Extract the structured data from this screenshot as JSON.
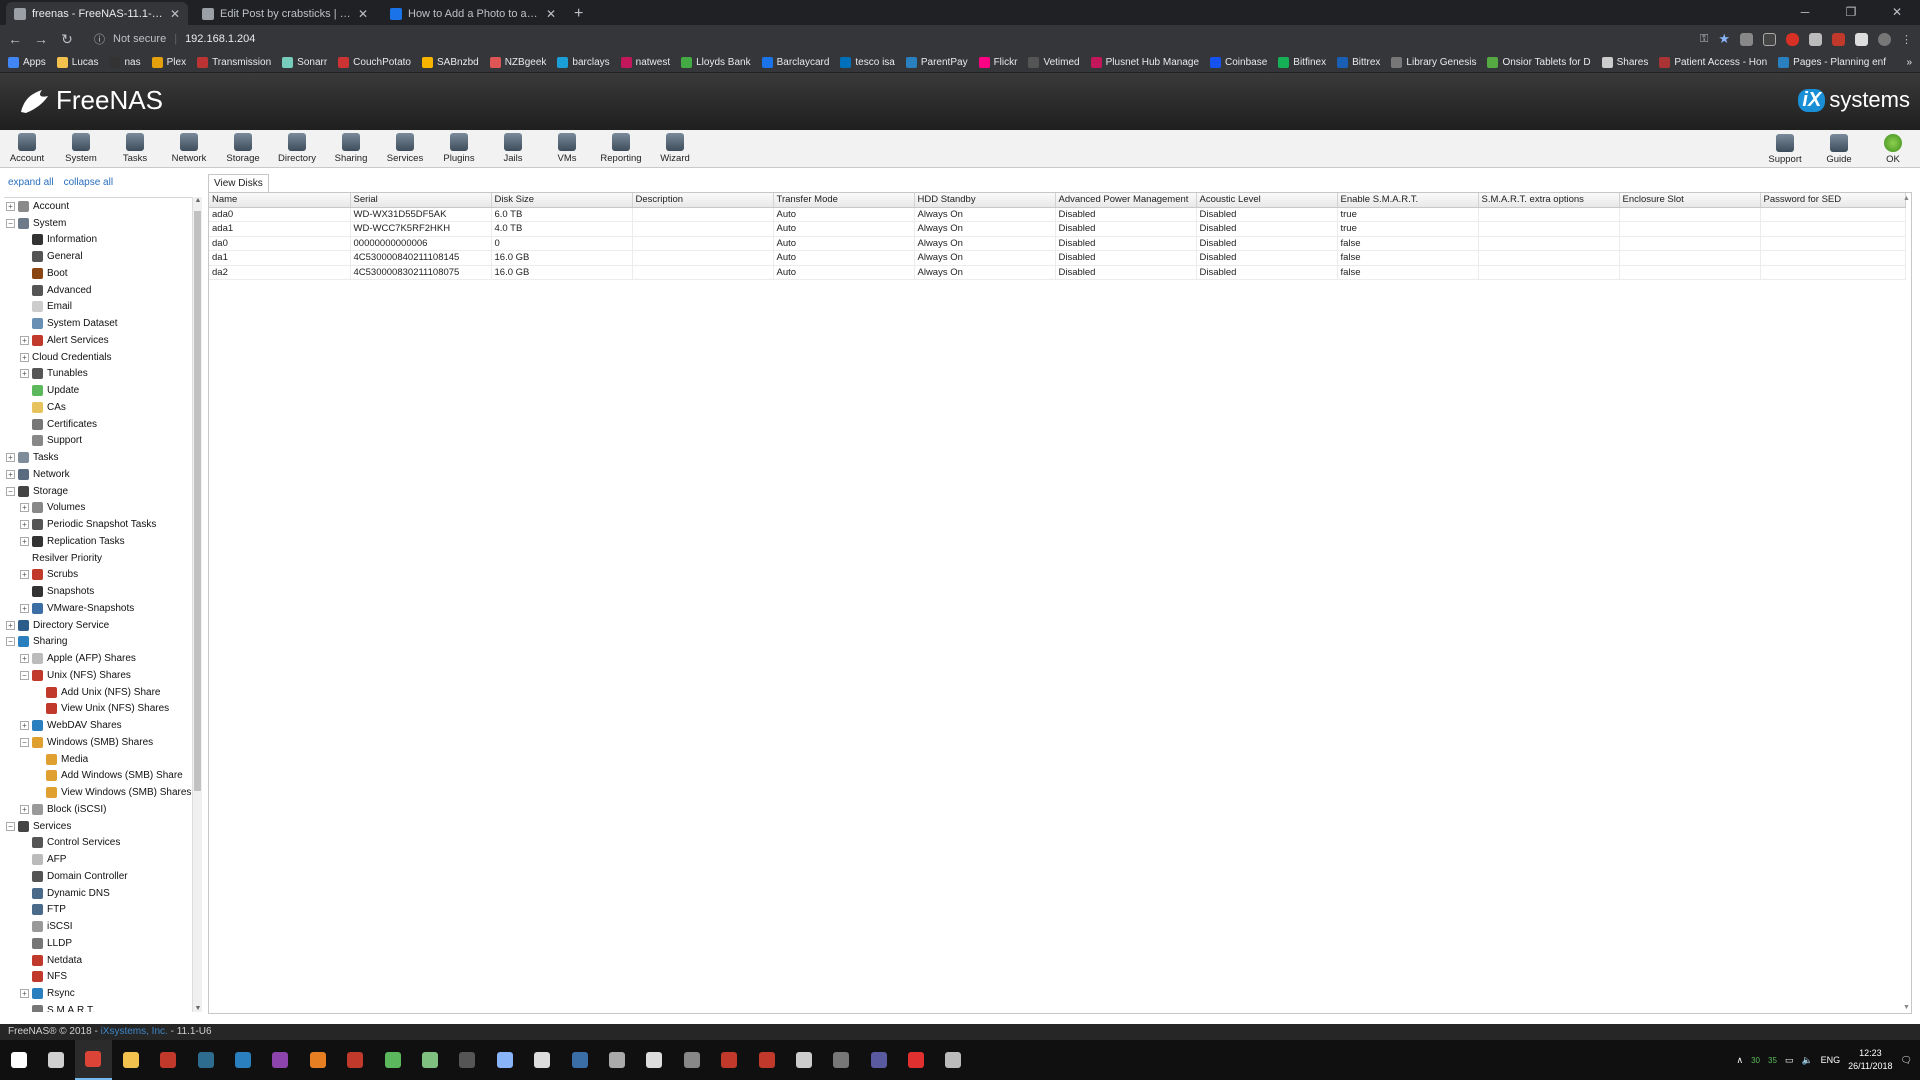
{
  "browser": {
    "tabs": [
      {
        "title": "freenas - FreeNAS-11.1-U6 (caffe",
        "active": true,
        "icon": "freenas-icon"
      },
      {
        "title": "Edit Post by crabsticks | FreeNAS",
        "active": false,
        "icon": "freenas-icon"
      },
      {
        "title": "How to Add a Photo to a Forum",
        "active": false,
        "icon": "p-icon"
      }
    ],
    "new_tab": "+",
    "security_label": "Not secure",
    "url": "192.168.1.204",
    "bookmarks": [
      "Apps",
      "Lucas",
      "nas",
      "Plex",
      "Transmission",
      "Sonarr",
      "CouchPotato",
      "SABnzbd",
      "NZBgeek",
      "barclays",
      "natwest",
      "Lloyds Bank",
      "Barclaycard",
      "tesco isa",
      "ParentPay",
      "Flickr",
      "Vetimed",
      "Plusnet Hub Manage",
      "Coinbase",
      "Bitfinex",
      "Bittrex",
      "Library Genesis",
      "Onsior Tablets for D",
      "Shares",
      "Patient Access - Hon",
      "Pages - Planning enf"
    ],
    "bookmarks_more": "»"
  },
  "app": {
    "logo_text": "FreeNAS",
    "vendor_logo_prefix": "iX",
    "vendor_logo_text": "systems",
    "toolbar_left": [
      "Account",
      "System",
      "Tasks",
      "Network",
      "Storage",
      "Directory",
      "Sharing",
      "Services",
      "Plugins",
      "Jails",
      "VMs",
      "Reporting",
      "Wizard"
    ],
    "toolbar_right": [
      "Support",
      "Guide",
      "OK"
    ],
    "expand_all": "expand all",
    "collapse_all": "collapse all",
    "footer_prefix": "FreeNAS® © 2018 - ",
    "footer_link": "iXsystems, Inc.",
    "footer_suffix": " - 11.1-U6"
  },
  "tree": [
    {
      "label": "Account",
      "level": 0,
      "exp": "+",
      "color": "#8a8a8a"
    },
    {
      "label": "System",
      "level": 0,
      "exp": "-",
      "color": "#6c7a89"
    },
    {
      "label": "Information",
      "level": 1,
      "exp": "",
      "color": "#333333"
    },
    {
      "label": "General",
      "level": 1,
      "exp": "",
      "color": "#555555"
    },
    {
      "label": "Boot",
      "level": 1,
      "exp": "",
      "color": "#8b4513"
    },
    {
      "label": "Advanced",
      "level": 1,
      "exp": "",
      "color": "#555555"
    },
    {
      "label": "Email",
      "level": 1,
      "exp": "",
      "color": "#cccccc"
    },
    {
      "label": "System Dataset",
      "level": 1,
      "exp": "",
      "color": "#6a8fb5"
    },
    {
      "label": "Alert Services",
      "level": 1,
      "exp": "+",
      "color": "#c0392b"
    },
    {
      "label": "Cloud Credentials",
      "level": 1,
      "exp": "+",
      "color": ""
    },
    {
      "label": "Tunables",
      "level": 1,
      "exp": "+",
      "color": "#555555"
    },
    {
      "label": "Update",
      "level": 1,
      "exp": "",
      "color": "#5cb85c"
    },
    {
      "label": "CAs",
      "level": 1,
      "exp": "",
      "color": "#e6c35c"
    },
    {
      "label": "Certificates",
      "level": 1,
      "exp": "",
      "color": "#777777"
    },
    {
      "label": "Support",
      "level": 1,
      "exp": "",
      "color": "#888888"
    },
    {
      "label": "Tasks",
      "level": 0,
      "exp": "+",
      "color": "#7f8c9a"
    },
    {
      "label": "Network",
      "level": 0,
      "exp": "+",
      "color": "#5a6d80"
    },
    {
      "label": "Storage",
      "level": 0,
      "exp": "-",
      "color": "#444444"
    },
    {
      "label": "Volumes",
      "level": 1,
      "exp": "+",
      "color": "#888888"
    },
    {
      "label": "Periodic Snapshot Tasks",
      "level": 1,
      "exp": "+",
      "color": "#555555"
    },
    {
      "label": "Replication Tasks",
      "level": 1,
      "exp": "+",
      "color": "#333333"
    },
    {
      "label": "Resilver Priority",
      "level": 1,
      "exp": "",
      "color": ""
    },
    {
      "label": "Scrubs",
      "level": 1,
      "exp": "+",
      "color": "#c0392b"
    },
    {
      "label": "Snapshots",
      "level": 1,
      "exp": "",
      "color": "#333333"
    },
    {
      "label": "VMware-Snapshots",
      "level": 1,
      "exp": "+",
      "color": "#3a6ea5"
    },
    {
      "label": "Directory Service",
      "level": 0,
      "exp": "+",
      "color": "#2c5d8a"
    },
    {
      "label": "Sharing",
      "level": 0,
      "exp": "-",
      "color": "#2a7fbf"
    },
    {
      "label": "Apple (AFP) Shares",
      "level": 1,
      "exp": "+",
      "color": "#bbbbbb"
    },
    {
      "label": "Unix (NFS) Shares",
      "level": 1,
      "exp": "-",
      "color": "#c0392b"
    },
    {
      "label": "Add Unix (NFS) Share",
      "level": 2,
      "exp": "",
      "color": "#c0392b"
    },
    {
      "label": "View Unix (NFS) Shares",
      "level": 2,
      "exp": "",
      "color": "#c0392b"
    },
    {
      "label": "WebDAV Shares",
      "level": 1,
      "exp": "+",
      "color": "#2a7fbf"
    },
    {
      "label": "Windows (SMB) Shares",
      "level": 1,
      "exp": "-",
      "color": "#e0a030"
    },
    {
      "label": "Media",
      "level": 2,
      "exp": "",
      "color": "#e0a030"
    },
    {
      "label": "Add Windows (SMB) Share",
      "level": 2,
      "exp": "",
      "color": "#e0a030"
    },
    {
      "label": "View Windows (SMB) Shares",
      "level": 2,
      "exp": "",
      "color": "#e0a030"
    },
    {
      "label": "Block (iSCSI)",
      "level": 1,
      "exp": "+",
      "color": "#999999"
    },
    {
      "label": "Services",
      "level": 0,
      "exp": "-",
      "color": "#444444"
    },
    {
      "label": "Control Services",
      "level": 1,
      "exp": "",
      "color": "#555555"
    },
    {
      "label": "AFP",
      "level": 1,
      "exp": "",
      "color": "#bbbbbb"
    },
    {
      "label": "Domain Controller",
      "level": 1,
      "exp": "",
      "color": "#555555"
    },
    {
      "label": "Dynamic DNS",
      "level": 1,
      "exp": "",
      "color": "#4a6a8a"
    },
    {
      "label": "FTP",
      "level": 1,
      "exp": "",
      "color": "#4a6a8a"
    },
    {
      "label": "iSCSI",
      "level": 1,
      "exp": "",
      "color": "#999999"
    },
    {
      "label": "LLDP",
      "level": 1,
      "exp": "",
      "color": "#777777"
    },
    {
      "label": "Netdata",
      "level": 1,
      "exp": "",
      "color": "#c0392b"
    },
    {
      "label": "NFS",
      "level": 1,
      "exp": "",
      "color": "#c0392b"
    },
    {
      "label": "Rsync",
      "level": 1,
      "exp": "+",
      "color": "#2a7fbf"
    },
    {
      "label": "S.M.A.R.T.",
      "level": 1,
      "exp": "",
      "color": "#777777"
    }
  ],
  "content": {
    "tab_label": "View Disks",
    "columns": [
      "Name",
      "Serial",
      "Disk Size",
      "Description",
      "Transfer Mode",
      "HDD Standby",
      "Advanced Power Management",
      "Acoustic Level",
      "Enable S.M.A.R.T.",
      "S.M.A.R.T. extra options",
      "Enclosure Slot",
      "Password for SED"
    ],
    "rows": [
      [
        "ada0",
        "WD-WX31D55DF5AK",
        "6.0 TB",
        "",
        "Auto",
        "Always On",
        "Disabled",
        "Disabled",
        "true",
        "",
        "",
        ""
      ],
      [
        "ada1",
        "WD-WCC7K5RF2HKH",
        "4.0 TB",
        "",
        "Auto",
        "Always On",
        "Disabled",
        "Disabled",
        "true",
        "",
        "",
        ""
      ],
      [
        "da0",
        "00000000000006",
        "0",
        "",
        "Auto",
        "Always On",
        "Disabled",
        "Disabled",
        "false",
        "",
        "",
        ""
      ],
      [
        "da1",
        "4C530000840211108145",
        "16.0 GB",
        "",
        "Auto",
        "Always On",
        "Disabled",
        "Disabled",
        "false",
        "",
        "",
        ""
      ],
      [
        "da2",
        "4C530000830211108075",
        "16.0 GB",
        "",
        "Auto",
        "Always On",
        "Disabled",
        "Disabled",
        "false",
        "",
        "",
        ""
      ]
    ]
  },
  "taskbar": {
    "apps": [
      {
        "icon": "windows-start-icon",
        "color": "#ffffff"
      },
      {
        "icon": "mail-icon",
        "color": "#d0d0d0"
      },
      {
        "icon": "chrome-icon",
        "color": "#db4437"
      },
      {
        "icon": "explorer-icon",
        "color": "#f2c14e"
      },
      {
        "icon": "app-icon",
        "color": "#c0392b"
      },
      {
        "icon": "lightroom-icon",
        "color": "#2d6b8f"
      },
      {
        "icon": "photoshop-icon",
        "color": "#2a7fbf"
      },
      {
        "icon": "app-icon",
        "color": "#8e44ad"
      },
      {
        "icon": "firefox-icon",
        "color": "#e67e22"
      },
      {
        "icon": "app-icon",
        "color": "#c0392b"
      },
      {
        "icon": "app-icon",
        "color": "#5cb85c"
      },
      {
        "icon": "app-icon",
        "color": "#7fbf7f"
      },
      {
        "icon": "app-icon",
        "color": "#555555"
      },
      {
        "icon": "app-icon",
        "color": "#8ab4f8"
      },
      {
        "icon": "app-icon",
        "color": "#dddddd"
      },
      {
        "icon": "steam-icon",
        "color": "#3a6ea5"
      },
      {
        "icon": "library-icon",
        "color": "#aaaaaa"
      },
      {
        "icon": "app-icon",
        "color": "#dddddd"
      },
      {
        "icon": "app-icon",
        "color": "#888888"
      },
      {
        "icon": "app-icon",
        "color": "#c0392b"
      },
      {
        "icon": "app-icon",
        "color": "#c0392b"
      },
      {
        "icon": "app-icon",
        "color": "#cccccc"
      },
      {
        "icon": "app-icon",
        "color": "#777777"
      },
      {
        "icon": "app-icon",
        "color": "#5a5aa0"
      },
      {
        "icon": "app-icon",
        "color": "#e03030"
      },
      {
        "icon": "app-icon",
        "color": "#bbbbbb"
      }
    ],
    "tray_up": "∧",
    "tray_n1": "30",
    "tray_n2": "35",
    "language": "ENG",
    "time": "12:23",
    "date": "26/11/2018"
  }
}
